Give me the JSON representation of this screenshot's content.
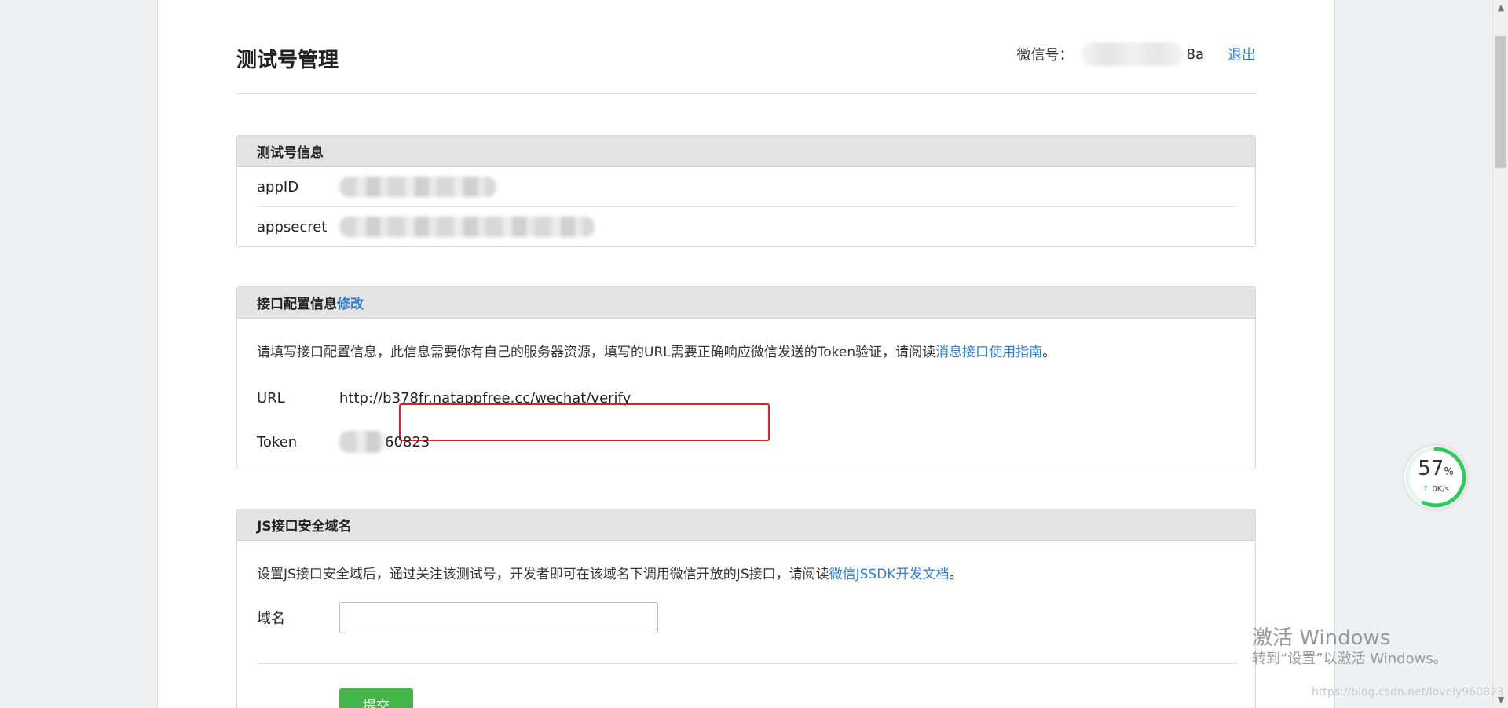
{
  "header": {
    "title": "测试号管理",
    "account_label": "微信号：",
    "account_suffix": "8a",
    "logout_label": "退出"
  },
  "test_info": {
    "title": "测试号信息",
    "appid_label": "appID",
    "appsecret_label": "appsecret"
  },
  "interface_config": {
    "title": "接口配置信息",
    "edit_label": "修改",
    "description": "请填写接口配置信息，此信息需要你有自己的服务器资源，填写的URL需要正确响应微信发送的Token验证，请阅读",
    "guide_link": "消息接口使用指南",
    "description_end": "。",
    "url_label": "URL",
    "url_value": "http://b378fr.natappfree.cc/wechat/verify",
    "token_label": "Token",
    "token_suffix": "60823"
  },
  "js_domain": {
    "title": "JS接口安全域名",
    "description": "设置JS接口安全域后，通过关注该测试号，开发者即可在该域名下调用微信开放的JS接口，请阅读",
    "doc_link": "微信JSSDK开发文档",
    "description_end": "。",
    "domain_label": "域名",
    "domain_value": "",
    "submit_label": "提交"
  },
  "speed_widget": {
    "percent": "57",
    "percent_unit": "%",
    "rate": "0K/s",
    "progress": 0.57,
    "color": "#2ecc5a"
  },
  "watermark": {
    "line1": "激活 Windows",
    "line2": "转到“设置”以激活 Windows。"
  },
  "blog_url": "https://blog.csdn.net/lovely960823"
}
